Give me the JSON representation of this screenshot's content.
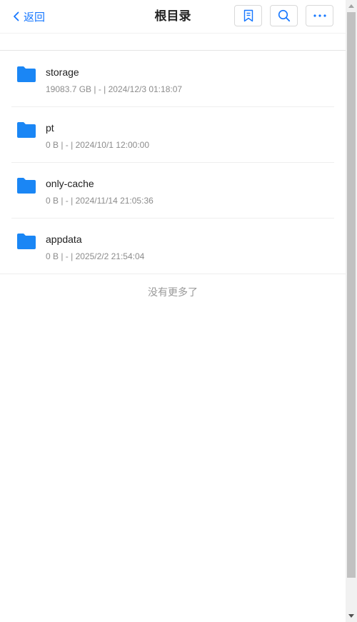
{
  "header": {
    "back_label": "返回",
    "title": "根目录",
    "buttons": {
      "bookmark_icon": "bookmark-icon",
      "search_icon": "search-icon",
      "more_icon": "ellipsis-icon"
    }
  },
  "accent_color": "#1677ff",
  "items": [
    {
      "name": "storage",
      "meta": "19083.7 GB | - | 2024/12/3 01:18:07",
      "icon": "folder-icon"
    },
    {
      "name": "pt",
      "meta": "0 B | - | 2024/10/1 12:00:00",
      "icon": "folder-icon"
    },
    {
      "name": "only-cache",
      "meta": "0 B | - | 2024/11/14 21:05:36",
      "icon": "folder-icon"
    },
    {
      "name": "appdata",
      "meta": "0 B | - | 2025/2/2 21:54:04",
      "icon": "folder-icon"
    }
  ],
  "footer": {
    "no_more_text": "没有更多了"
  }
}
